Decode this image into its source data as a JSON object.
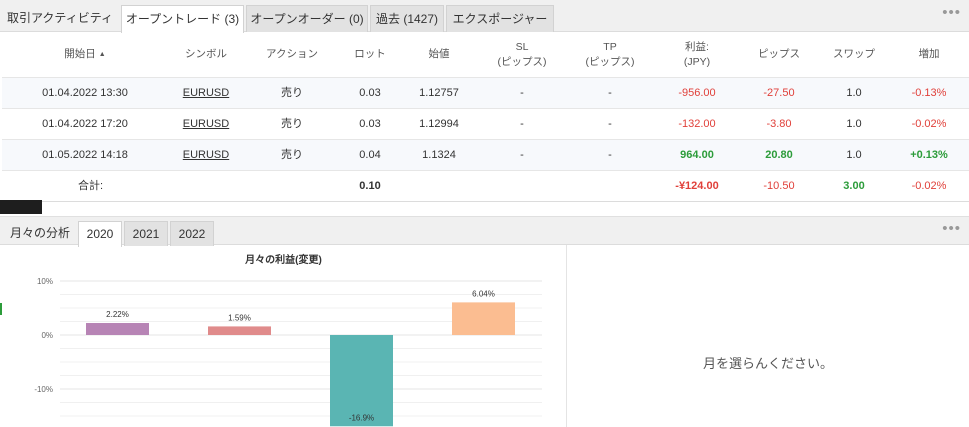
{
  "tabs": [
    {
      "label": "取引アクティビティ",
      "active": false
    },
    {
      "label": "オープントレード (3)",
      "active": true
    },
    {
      "label": "オープンオーダー (0)",
      "active": false
    },
    {
      "label": "過去 (1427)",
      "active": false
    },
    {
      "label": "エクスポージャー",
      "active": false
    }
  ],
  "more_label": "•••",
  "table": {
    "columns": [
      {
        "label": "開始日",
        "sort": "▲"
      },
      {
        "label": "シンボル"
      },
      {
        "label": "アクション"
      },
      {
        "label": "ロット"
      },
      {
        "label": "始値"
      },
      {
        "label": "SL",
        "label2": "(ピップス)"
      },
      {
        "label": "TP",
        "label2": "(ピップス)"
      },
      {
        "label": "利益:",
        "label2": "(JPY)"
      },
      {
        "label": "ピップス"
      },
      {
        "label": "スワップ"
      },
      {
        "label": "増加"
      }
    ],
    "rows": [
      {
        "date": "01.04.2022 13:30",
        "symbol": "EURUSD",
        "action": "売り",
        "lots": "0.03",
        "open": "1.12757",
        "sl": "-",
        "tp": "-",
        "profit": "-956.00",
        "pips": "-27.50",
        "swap": "1.0",
        "gain": "-0.13%"
      },
      {
        "date": "01.04.2022 17:20",
        "symbol": "EURUSD",
        "action": "売り",
        "lots": "0.03",
        "open": "1.12994",
        "sl": "-",
        "tp": "-",
        "profit": "-132.00",
        "pips": "-3.80",
        "swap": "1.0",
        "gain": "-0.02%"
      },
      {
        "date": "01.05.2022 14:18",
        "symbol": "EURUSD",
        "action": "売り",
        "lots": "0.04",
        "open": "1.1324",
        "sl": "-",
        "tp": "-",
        "profit": "964.00",
        "pips": "20.80",
        "swap": "1.0",
        "gain": "+0.13%"
      }
    ],
    "total": {
      "label": "合計:",
      "lots": "0.10",
      "profit": "-¥124.00",
      "pips": "-10.50",
      "swap": "3.00",
      "gain": "-0.02%"
    }
  },
  "monthly": {
    "tabs": [
      {
        "label": "月々の分析",
        "active": false
      },
      {
        "label": "2020",
        "active": true
      },
      {
        "label": "2021",
        "active": false
      },
      {
        "label": "2022",
        "active": false
      }
    ],
    "more_label": "•••",
    "placeholder": "月を選らんください。"
  },
  "chart_data": {
    "type": "bar",
    "title": "月々の利益(変更)",
    "values": [
      2.22,
      1.59,
      -16.9,
      6.04
    ],
    "labels": [
      "2.22%",
      "1.59%",
      "-16.9%",
      "6.04%"
    ],
    "colors": [
      "#b784b5",
      "#e08b8b",
      "#5ab5b3",
      "#fbbd91"
    ],
    "yticks": [
      {
        "value": 10,
        "label": "10%"
      },
      {
        "value": 0,
        "label": "0%"
      },
      {
        "value": -10,
        "label": "-10%"
      }
    ],
    "ylim": [
      -17,
      11
    ],
    "grid": true
  },
  "colors": {
    "negative": "#e0403a",
    "positive": "#2c9c3a"
  }
}
